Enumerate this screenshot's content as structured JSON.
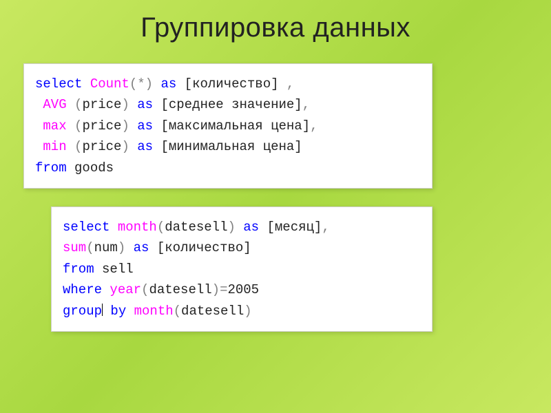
{
  "title": "Группировка данных",
  "code1": {
    "l1": {
      "select": "select",
      "count": "Count",
      "lp": "(",
      "star": "*",
      "rp": ")",
      "as": "as",
      "alias": " [количество] ",
      "comma": ","
    },
    "l2": {
      "avg": "AVG",
      "sp": " ",
      "lp": "(",
      "arg": "price",
      "rp": ")",
      "as": "as",
      "alias": " [среднее значение]",
      "comma": ","
    },
    "l3": {
      "max": "max",
      "sp": " ",
      "lp": "(",
      "arg": "price",
      "rp": ")",
      "as": "as",
      "alias": " [максимальная цена]",
      "comma": ","
    },
    "l4": {
      "min": "min",
      "sp": " ",
      "lp": "(",
      "arg": "price",
      "rp": ")",
      "as": "as",
      "alias": " [минимальная цена]"
    },
    "l5": {
      "from": "from",
      "tbl": " goods"
    }
  },
  "code2": {
    "l1": {
      "select": "select",
      "month": "month",
      "lp": "(",
      "arg": "datesell",
      "rp": ")",
      "as": "as",
      "alias": " [месяц]",
      "comma": ","
    },
    "l2": {
      "sum": "sum",
      "lp": "(",
      "arg": "num",
      "rp": ")",
      "as": "as",
      "alias": " [количество]"
    },
    "l3": {
      "from": "from",
      "tbl": " sell"
    },
    "l4": {
      "where": "where",
      "sp": " ",
      "year": "year",
      "lp": "(",
      "arg": "datesell",
      "rp": ")",
      "eq": "=",
      "val": "2005"
    },
    "l5": {
      "group": "group",
      "by": " by ",
      "month": "month",
      "lp": "(",
      "arg": "datesell",
      "rp": ")"
    }
  }
}
